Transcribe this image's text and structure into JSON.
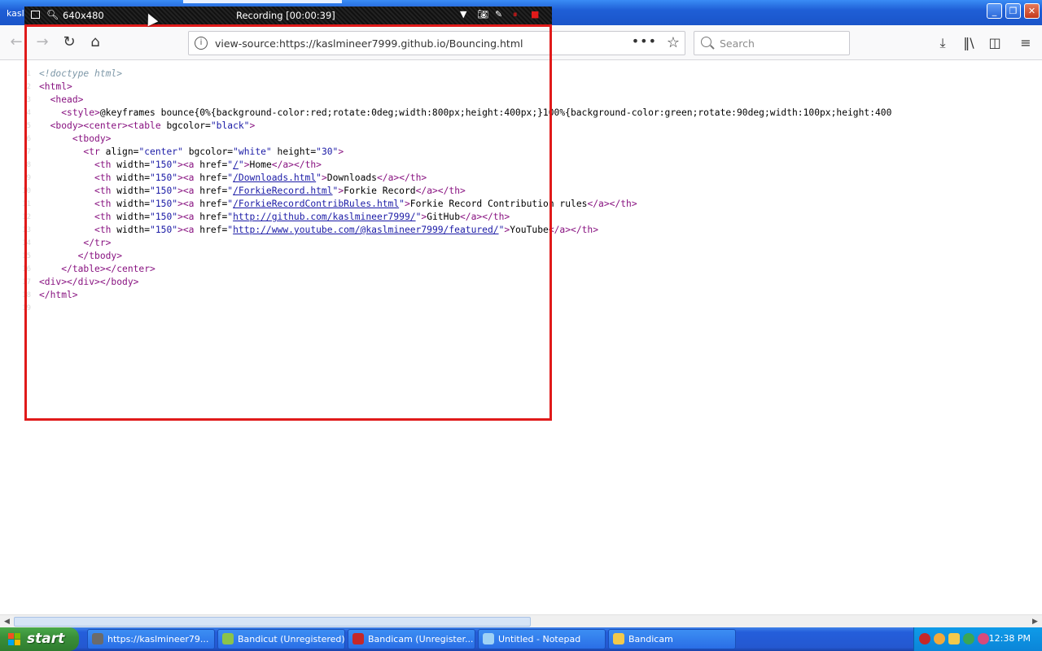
{
  "window": {
    "title": "kasl"
  },
  "nav": {
    "url": "view-source:https://kaslmineer7999.github.io/Bouncing.html",
    "search_placeholder": "Search"
  },
  "recording": {
    "size": "640x480",
    "status": "Recording [00:00:39]"
  },
  "source_lines": [
    {
      "n": "1",
      "html": "<span class='cmt'>&lt;!doctype html&gt;</span>"
    },
    {
      "n": "2",
      "html": "<span class='tag'>&lt;html&gt;</span>"
    },
    {
      "n": "3",
      "html": "  <span class='tag'>&lt;head&gt;</span>"
    },
    {
      "n": "4",
      "html": "    <span class='tag'>&lt;style&gt;</span>@keyframes bounce{0%{background-color:red;rotate:0deg;width:800px;height:400px;}100%{background-color:green;rotate:90deg;width:100px;height:400"
    },
    {
      "n": "5",
      "html": "  <span class='tag'>&lt;body&gt;&lt;center&gt;&lt;table</span> <span class='attr'>bgcolor=</span><span class='val'>\"black\"</span><span class='tag'>&gt;</span>"
    },
    {
      "n": "6",
      "html": "      <span class='tag'>&lt;tbody&gt;</span>"
    },
    {
      "n": "7",
      "html": "        <span class='tag'>&lt;tr</span> <span class='attr'>align=</span><span class='val'>\"center\"</span> <span class='attr'>bgcolor=</span><span class='val'>\"white\"</span> <span class='attr'>height=</span><span class='val'>\"30\"</span><span class='tag'>&gt;</span>"
    },
    {
      "n": "8",
      "html": "          <span class='tag'>&lt;th</span> <span class='attr'>width=</span><span class='val'>\"150\"</span><span class='tag'>&gt;&lt;a</span> <span class='attr'>href=</span><span class='val'>\"</span><span class='lnk'>/</span><span class='val'>\"</span><span class='tag'>&gt;</span>Home<span class='tag'>&lt;/a&gt;&lt;/th&gt;</span>"
    },
    {
      "n": "9",
      "html": "          <span class='tag'>&lt;th</span> <span class='attr'>width=</span><span class='val'>\"150\"</span><span class='tag'>&gt;&lt;a</span> <span class='attr'>href=</span><span class='val'>\"</span><span class='lnk'>/Downloads.html</span><span class='val'>\"</span><span class='tag'>&gt;</span>Downloads<span class='tag'>&lt;/a&gt;&lt;/th&gt;</span>"
    },
    {
      "n": "10",
      "html": "          <span class='tag'>&lt;th</span> <span class='attr'>width=</span><span class='val'>\"150\"</span><span class='tag'>&gt;&lt;a</span> <span class='attr'>href=</span><span class='val'>\"</span><span class='lnk'>/ForkieRecord.html</span><span class='val'>\"</span><span class='tag'>&gt;</span>Forkie Record<span class='tag'>&lt;/a&gt;&lt;/th&gt;</span>"
    },
    {
      "n": "11",
      "html": "          <span class='tag'>&lt;th</span> <span class='attr'>width=</span><span class='val'>\"150\"</span><span class='tag'>&gt;&lt;a</span> <span class='attr'>href=</span><span class='val'>\"</span><span class='lnk'>/ForkieRecordContribRules.html</span><span class='val'>\"</span><span class='tag'>&gt;</span>Forkie Record Contribution rules<span class='tag'>&lt;/a&gt;&lt;/th&gt;</span>"
    },
    {
      "n": "12",
      "html": "          <span class='tag'>&lt;th</span> <span class='attr'>width=</span><span class='val'>\"150\"</span><span class='tag'>&gt;&lt;a</span> <span class='attr'>href=</span><span class='val'>\"</span><span class='lnk'>http://github.com/kaslmineer7999/</span><span class='val'>\"</span><span class='tag'>&gt;</span>GitHub<span class='tag'>&lt;/a&gt;&lt;/th&gt;</span>"
    },
    {
      "n": "13",
      "html": "          <span class='tag'>&lt;th</span> <span class='attr'>width=</span><span class='val'>\"150\"</span><span class='tag'>&gt;&lt;a</span> <span class='attr'>href=</span><span class='val'>\"</span><span class='lnk'>http://www.youtube.com/@kaslmineer7999/featured/</span><span class='val'>\"</span><span class='tag'>&gt;</span>YouTube<span class='tag'>&lt;/a&gt;&lt;/th&gt;</span>"
    },
    {
      "n": "14",
      "html": "        <span class='tag'>&lt;/tr&gt;</span>"
    },
    {
      "n": "15",
      "html": "       <span class='tag'>&lt;/tbody&gt;</span>"
    },
    {
      "n": "16",
      "html": "    <span class='tag'>&lt;/table&gt;&lt;/center&gt;</span>"
    },
    {
      "n": "17",
      "html": "<span class='tag'>&lt;div&gt;&lt;/div&gt;&lt;/body&gt;</span>"
    },
    {
      "n": "18",
      "html": "<span class='tag'>&lt;/html&gt;</span>"
    },
    {
      "n": "19",
      "html": ""
    }
  ],
  "taskbar": {
    "start_label": "start",
    "tasks": [
      {
        "label": "https://kaslmineer79...",
        "icon_color": "#6b6b6b"
      },
      {
        "label": "Bandicut (Unregistered)",
        "icon_color": "#8bc34a"
      },
      {
        "label": "Bandicam (Unregister...",
        "icon_color": "#c62828"
      },
      {
        "label": "Untitled - Notepad",
        "icon_color": "#9fd2f5"
      },
      {
        "label": "Bandicam",
        "icon_color": "#f2c94c"
      }
    ],
    "clock": "12:38 PM"
  },
  "colors": {
    "rec_border": "#e01a1a",
    "xp_blue": "#245edb",
    "start_green": "#3a8f3a"
  }
}
